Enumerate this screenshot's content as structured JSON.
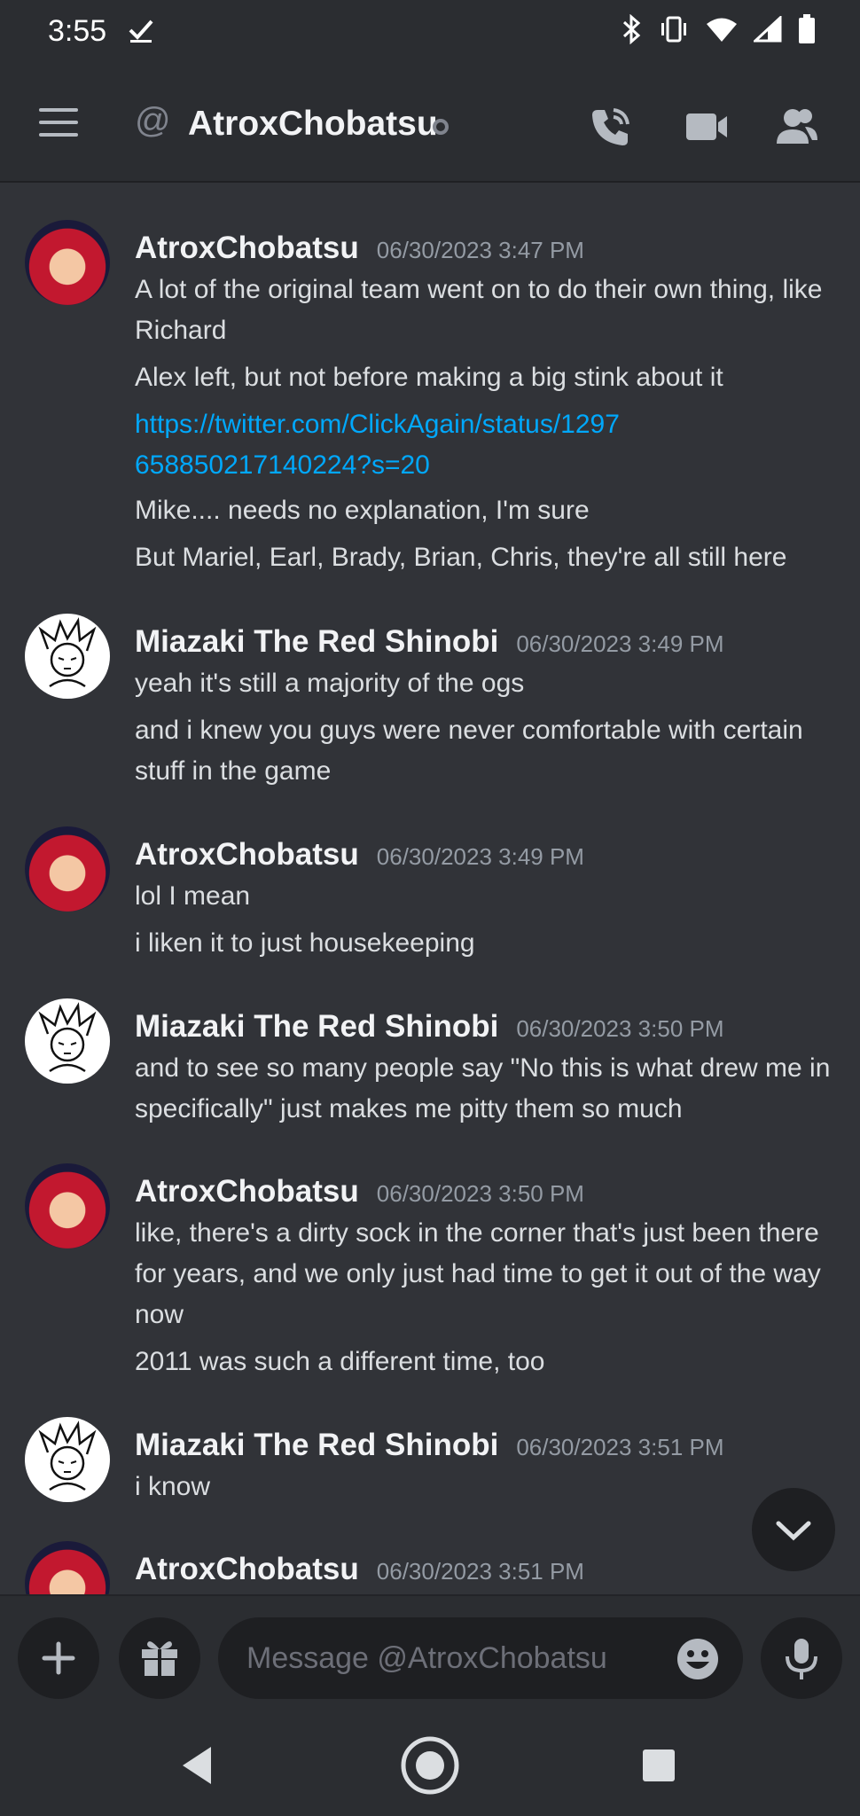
{
  "status_bar": {
    "time": "3:55",
    "icons": [
      "check-icon",
      "bluetooth-icon",
      "vibrate-icon",
      "wifi-icon",
      "signal-icon",
      "battery-icon"
    ]
  },
  "header": {
    "channel_icon": "@",
    "title": "AtroxChobatsu",
    "icons": [
      "menu-icon",
      "call-icon",
      "video-icon",
      "members-icon"
    ]
  },
  "messages": [
    {
      "author": "AtroxChobatsu",
      "timestamp": "06/30/2023 3:47 PM",
      "lines": [
        "A lot of the original team went on to do their own thing, like Richard",
        "Alex left, but not before making a big stink about it",
        "https://twitter.com/ClickAgain/status/1297658850217140224?s=20",
        "Mike.... needs no explanation, I'm sure",
        "But Mariel, Earl, Brady, Brian, Chris, they're all still here"
      ]
    },
    {
      "author": "Miazaki The Red Shinobi",
      "timestamp": "06/30/2023 3:49 PM",
      "lines": [
        "yeah it's still a majority of the ogs",
        "and i knew you guys were never comfortable with certain stuff in the game"
      ]
    },
    {
      "author": "AtroxChobatsu",
      "timestamp": "06/30/2023 3:49 PM",
      "lines": [
        "lol I mean",
        "i liken it to just housekeeping"
      ]
    },
    {
      "author": "Miazaki The Red Shinobi",
      "timestamp": "06/30/2023 3:50 PM",
      "lines": [
        "and to see so many people say \"No this is what drew me in specifically\" just makes me pitty them so much"
      ]
    },
    {
      "author": "AtroxChobatsu",
      "timestamp": "06/30/2023 3:50 PM",
      "lines": [
        "like, there's a dirty sock in the corner that's just been there for years, and we only just had time to get it out of the way now",
        "2011 was such a different time, too"
      ]
    },
    {
      "author": "Miazaki The Red Shinobi",
      "timestamp": "06/30/2023 3:51 PM",
      "lines": [
        "i know"
      ]
    },
    {
      "author": "AtroxChobatsu",
      "timestamp": "06/30/2023 3:51 PM",
      "lines": []
    }
  ],
  "composer": {
    "placeholder": "Message @AtroxChobatsu"
  },
  "colors": {
    "background": "#313338",
    "link": "#00a8fc",
    "timestamp": "#949ba4"
  }
}
